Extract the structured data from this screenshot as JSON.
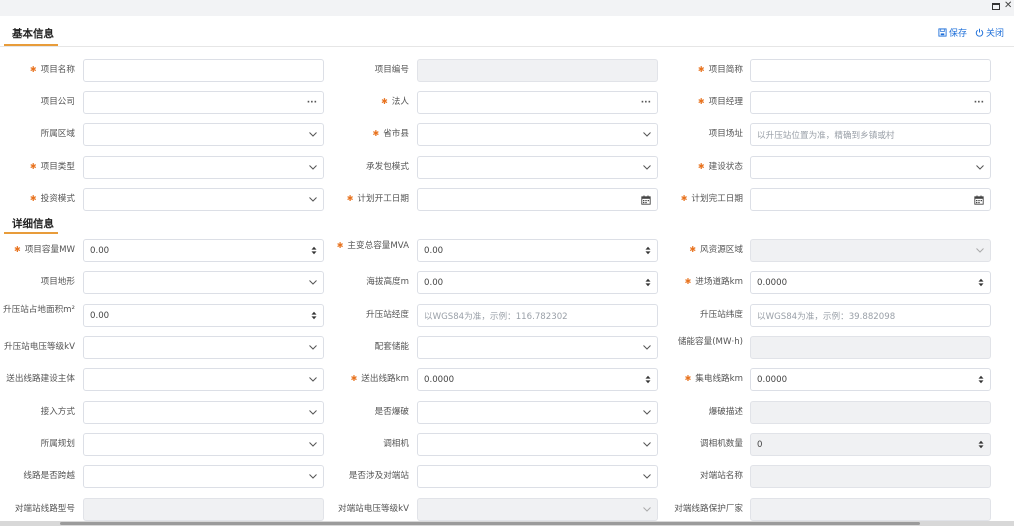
{
  "basic_section": {
    "title": "基本信息"
  },
  "detail_section": {
    "title": "详细信息"
  },
  "actions": {
    "save": "保存",
    "close": "关闭"
  },
  "fields": [
    {
      "label": "项目名称",
      "required": true,
      "type": "text",
      "value": "",
      "placeholder": ""
    },
    {
      "label": "项目编号",
      "required": false,
      "type": "disabled",
      "value": "",
      "placeholder": ""
    },
    {
      "label": "项目简称",
      "required": true,
      "type": "text",
      "value": "",
      "placeholder": ""
    },
    {
      "label": "项目公司",
      "required": false,
      "type": "lookup",
      "value": "",
      "placeholder": ""
    },
    {
      "label": "法人",
      "required": true,
      "type": "lookup",
      "value": "",
      "placeholder": ""
    },
    {
      "label": "项目经理",
      "required": true,
      "type": "lookup",
      "value": "",
      "placeholder": ""
    },
    {
      "label": "所属区域",
      "required": false,
      "type": "select",
      "value": "",
      "placeholder": ""
    },
    {
      "label": "省市县",
      "required": true,
      "type": "select",
      "value": "",
      "placeholder": ""
    },
    {
      "label": "项目场址",
      "required": false,
      "type": "text",
      "value": "",
      "placeholder": "以升压站位置为准，精确到乡镇或村"
    },
    {
      "label": "项目类型",
      "required": true,
      "type": "select",
      "value": "",
      "placeholder": ""
    },
    {
      "label": "承发包模式",
      "required": false,
      "type": "select",
      "value": "",
      "placeholder": ""
    },
    {
      "label": "建设状态",
      "required": true,
      "type": "select",
      "value": "",
      "placeholder": ""
    },
    {
      "label": "投资模式",
      "required": true,
      "type": "select",
      "value": "",
      "placeholder": ""
    },
    {
      "label": "计划开工日期",
      "required": true,
      "type": "date",
      "value": "",
      "placeholder": ""
    },
    {
      "label": "计划完工日期",
      "required": true,
      "type": "date",
      "value": "",
      "placeholder": ""
    },
    {
      "label": "项目容量MW",
      "required": true,
      "type": "number",
      "value": "0.00",
      "placeholder": ""
    },
    {
      "label": "主变总容量MVA",
      "required": true,
      "type": "number",
      "value": "0.00",
      "placeholder": "",
      "two_line": true
    },
    {
      "label": "风资源区域",
      "required": true,
      "type": "select-disabled",
      "value": "",
      "placeholder": ""
    },
    {
      "label": "项目地形",
      "required": false,
      "type": "select",
      "value": "",
      "placeholder": ""
    },
    {
      "label": "海拔高度m",
      "required": false,
      "type": "number",
      "value": "0.00",
      "placeholder": ""
    },
    {
      "label": "进场道路km",
      "required": true,
      "type": "number",
      "value": "0.0000",
      "placeholder": ""
    },
    {
      "label": "升压站占地面积m²",
      "required": false,
      "type": "number",
      "value": "0.00",
      "placeholder": "",
      "two_line": true
    },
    {
      "label": "升压站经度",
      "required": false,
      "type": "text",
      "value": "",
      "placeholder": "以WGS84为准，示例：116.782302"
    },
    {
      "label": "升压站纬度",
      "required": false,
      "type": "text",
      "value": "",
      "placeholder": "以WGS84为准，示例：39.882098"
    },
    {
      "label": "升压站电压等级kV",
      "required": false,
      "type": "select",
      "value": "",
      "placeholder": ""
    },
    {
      "label": "配套储能",
      "required": false,
      "type": "select",
      "value": "",
      "placeholder": ""
    },
    {
      "label": "储能容量(MW·h)",
      "required": false,
      "type": "disabled",
      "value": "",
      "placeholder": "",
      "two_line": true
    },
    {
      "label": "送出线路建设主体",
      "required": false,
      "type": "select",
      "value": "",
      "placeholder": ""
    },
    {
      "label": "送出线路km",
      "required": true,
      "type": "number",
      "value": "0.0000",
      "placeholder": ""
    },
    {
      "label": "集电线路km",
      "required": true,
      "type": "number",
      "value": "0.0000",
      "placeholder": ""
    },
    {
      "label": "接入方式",
      "required": false,
      "type": "select",
      "value": "",
      "placeholder": ""
    },
    {
      "label": "是否爆破",
      "required": false,
      "type": "select",
      "value": "",
      "placeholder": ""
    },
    {
      "label": "爆破描述",
      "required": false,
      "type": "disabled",
      "value": "",
      "placeholder": ""
    },
    {
      "label": "所属规划",
      "required": false,
      "type": "select",
      "value": "",
      "placeholder": ""
    },
    {
      "label": "调相机",
      "required": false,
      "type": "select",
      "value": "",
      "placeholder": ""
    },
    {
      "label": "调相机数量",
      "required": false,
      "type": "number-disabled",
      "value": "0",
      "placeholder": ""
    },
    {
      "label": "线路是否跨越",
      "required": false,
      "type": "select",
      "value": "",
      "placeholder": ""
    },
    {
      "label": "是否涉及对端站",
      "required": false,
      "type": "select",
      "value": "",
      "placeholder": ""
    },
    {
      "label": "对端站名称",
      "required": false,
      "type": "disabled",
      "value": "",
      "placeholder": ""
    },
    {
      "label": "对端站线路型号",
      "required": false,
      "type": "disabled",
      "value": "",
      "placeholder": ""
    },
    {
      "label": "对端站电压等级kV",
      "required": false,
      "type": "select-disabled",
      "value": "",
      "placeholder": ""
    },
    {
      "label": "对端线路保护厂家",
      "required": false,
      "type": "disabled",
      "value": "",
      "placeholder": ""
    }
  ]
}
